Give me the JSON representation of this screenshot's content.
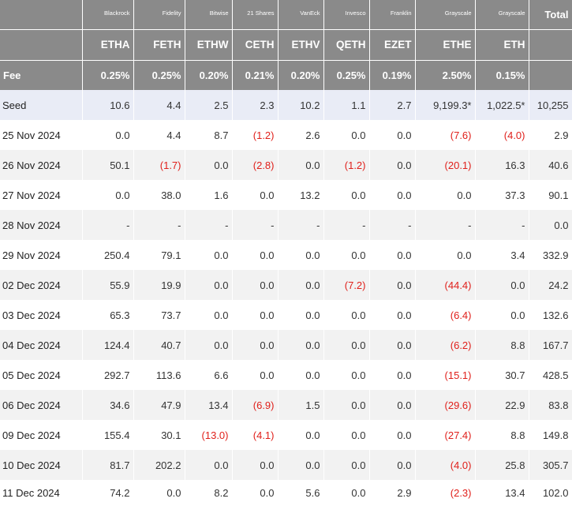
{
  "issuers": [
    "Blackrock",
    "Fidelity",
    "Bitwise",
    "21 Shares",
    "VanEck",
    "Invesco",
    "Franklin",
    "Grayscale",
    "Grayscale"
  ],
  "total_label": "Total",
  "tickers": [
    "ETHA",
    "FETH",
    "ETHW",
    "CETH",
    "ETHV",
    "QETH",
    "EZET",
    "ETHE",
    "ETH"
  ],
  "fee_label": "Fee",
  "fees": [
    "0.25%",
    "0.25%",
    "0.20%",
    "0.21%",
    "0.20%",
    "0.25%",
    "0.19%",
    "2.50%",
    "0.15%"
  ],
  "colors": {
    "header_bg": "#8a8a8a",
    "seed_row_bg": "#e9ecf6",
    "alt_row_bg": "#f2f2f2",
    "negative_text": "#e0201b"
  },
  "rows": [
    {
      "label": "Seed",
      "values": [
        "10.6",
        "4.4",
        "2.5",
        "2.3",
        "10.2",
        "1.1",
        "2.7",
        "9,199.3*",
        "1,022.5*",
        "10,255"
      ]
    },
    {
      "label": "25 Nov 2024",
      "values": [
        "0.0",
        "4.4",
        "8.7",
        "(1.2)",
        "2.6",
        "0.0",
        "0.0",
        "(7.6)",
        "(4.0)",
        "2.9"
      ]
    },
    {
      "label": "26 Nov 2024",
      "values": [
        "50.1",
        "(1.7)",
        "0.0",
        "(2.8)",
        "0.0",
        "(1.2)",
        "0.0",
        "(20.1)",
        "16.3",
        "40.6"
      ]
    },
    {
      "label": "27 Nov 2024",
      "values": [
        "0.0",
        "38.0",
        "1.6",
        "0.0",
        "13.2",
        "0.0",
        "0.0",
        "0.0",
        "37.3",
        "90.1"
      ]
    },
    {
      "label": "28 Nov 2024",
      "values": [
        "-",
        "-",
        "-",
        "-",
        "-",
        "-",
        "-",
        "-",
        "-",
        "0.0"
      ]
    },
    {
      "label": "29 Nov 2024",
      "values": [
        "250.4",
        "79.1",
        "0.0",
        "0.0",
        "0.0",
        "0.0",
        "0.0",
        "0.0",
        "3.4",
        "332.9"
      ]
    },
    {
      "label": "02 Dec 2024",
      "values": [
        "55.9",
        "19.9",
        "0.0",
        "0.0",
        "0.0",
        "(7.2)",
        "0.0",
        "(44.4)",
        "0.0",
        "24.2"
      ]
    },
    {
      "label": "03 Dec 2024",
      "values": [
        "65.3",
        "73.7",
        "0.0",
        "0.0",
        "0.0",
        "0.0",
        "0.0",
        "(6.4)",
        "0.0",
        "132.6"
      ]
    },
    {
      "label": "04 Dec 2024",
      "values": [
        "124.4",
        "40.7",
        "0.0",
        "0.0",
        "0.0",
        "0.0",
        "0.0",
        "(6.2)",
        "8.8",
        "167.7"
      ]
    },
    {
      "label": "05 Dec 2024",
      "values": [
        "292.7",
        "113.6",
        "6.6",
        "0.0",
        "0.0",
        "0.0",
        "0.0",
        "(15.1)",
        "30.7",
        "428.5"
      ]
    },
    {
      "label": "06 Dec 2024",
      "values": [
        "34.6",
        "47.9",
        "13.4",
        "(6.9)",
        "1.5",
        "0.0",
        "0.0",
        "(29.6)",
        "22.9",
        "83.8"
      ]
    },
    {
      "label": "09 Dec 2024",
      "values": [
        "155.4",
        "30.1",
        "(13.0)",
        "(4.1)",
        "0.0",
        "0.0",
        "0.0",
        "(27.4)",
        "8.8",
        "149.8"
      ]
    },
    {
      "label": "10 Dec 2024",
      "values": [
        "81.7",
        "202.2",
        "0.0",
        "0.0",
        "0.0",
        "0.0",
        "0.0",
        "(4.0)",
        "25.8",
        "305.7"
      ]
    },
    {
      "label": "11 Dec 2024",
      "values": [
        "74.2",
        "0.0",
        "8.2",
        "0.0",
        "5.6",
        "0.0",
        "2.9",
        "(2.3)",
        "13.4",
        "102.0"
      ]
    }
  ]
}
